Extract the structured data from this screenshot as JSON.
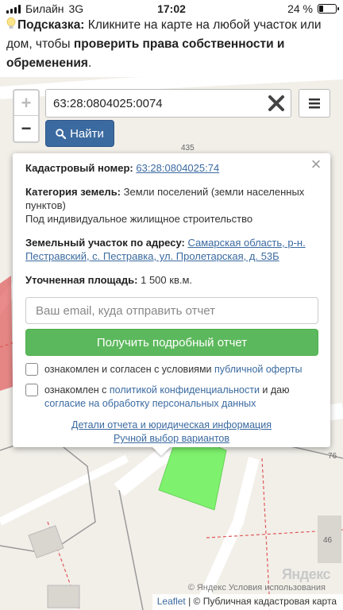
{
  "status_bar": {
    "carrier": "Билайн",
    "network": "3G",
    "time": "17:02",
    "battery_text": "24 %",
    "battery_level": 0.24
  },
  "hint": {
    "label": "Подсказка:",
    "text_1": " Кликните на карте на любой участок или дом, чтобы ",
    "text_bold": "проверить права собственности и обременения",
    "text_2": "."
  },
  "map": {
    "labels": [
      "435",
      "76",
      "46"
    ],
    "zoom_in": "+",
    "zoom_out": "−",
    "search_value": "63:28:0804025:0074",
    "find_label": "Найти",
    "attribution_leaflet": "Leaflet",
    "attribution_sep": " | © ",
    "attribution_source": "Публичная кадастровая карта",
    "yandex_terms": "© Яндекс  Условия использования",
    "yandex_logo": "Яндекс",
    "parcel_color": "#7ef26e"
  },
  "popup": {
    "close": "×",
    "cadastral_label": "Кадастровый номер:",
    "cadastral_value": "63:28:0804025:74",
    "category_label": "Категория земель:",
    "category_value": "Земли поселений (земли населенных пунктов)",
    "usage": "Под индивидуальное жилищное строительство",
    "address_label": "Земельный участок по адресу:",
    "address_value": "Самарская область, р-н. Пестравский, с. Пестравка, ул. Пролетарская, д. 53Б",
    "area_label": "Уточненная площадь:",
    "area_value": "1 500 кв.м.",
    "email_placeholder": "Ваш email, куда отправить отчет",
    "report_button": "Получить подробный отчет",
    "check1_text": "ознакомлен и согласен с условиями ",
    "check1_link": "публичной оферты",
    "check2_text1": "ознакомлен с ",
    "check2_link1": "политикой конфиденциальности",
    "check2_text2": " и даю ",
    "check2_link2": "согласие на обработку персональных данных",
    "details_link": "Детали отчета и юридическая информация",
    "manual_link": "Ручной выбор вариантов"
  },
  "colors": {
    "primary": "#3b6aa0",
    "success": "#5cb85c",
    "link": "#3b6aa0"
  }
}
